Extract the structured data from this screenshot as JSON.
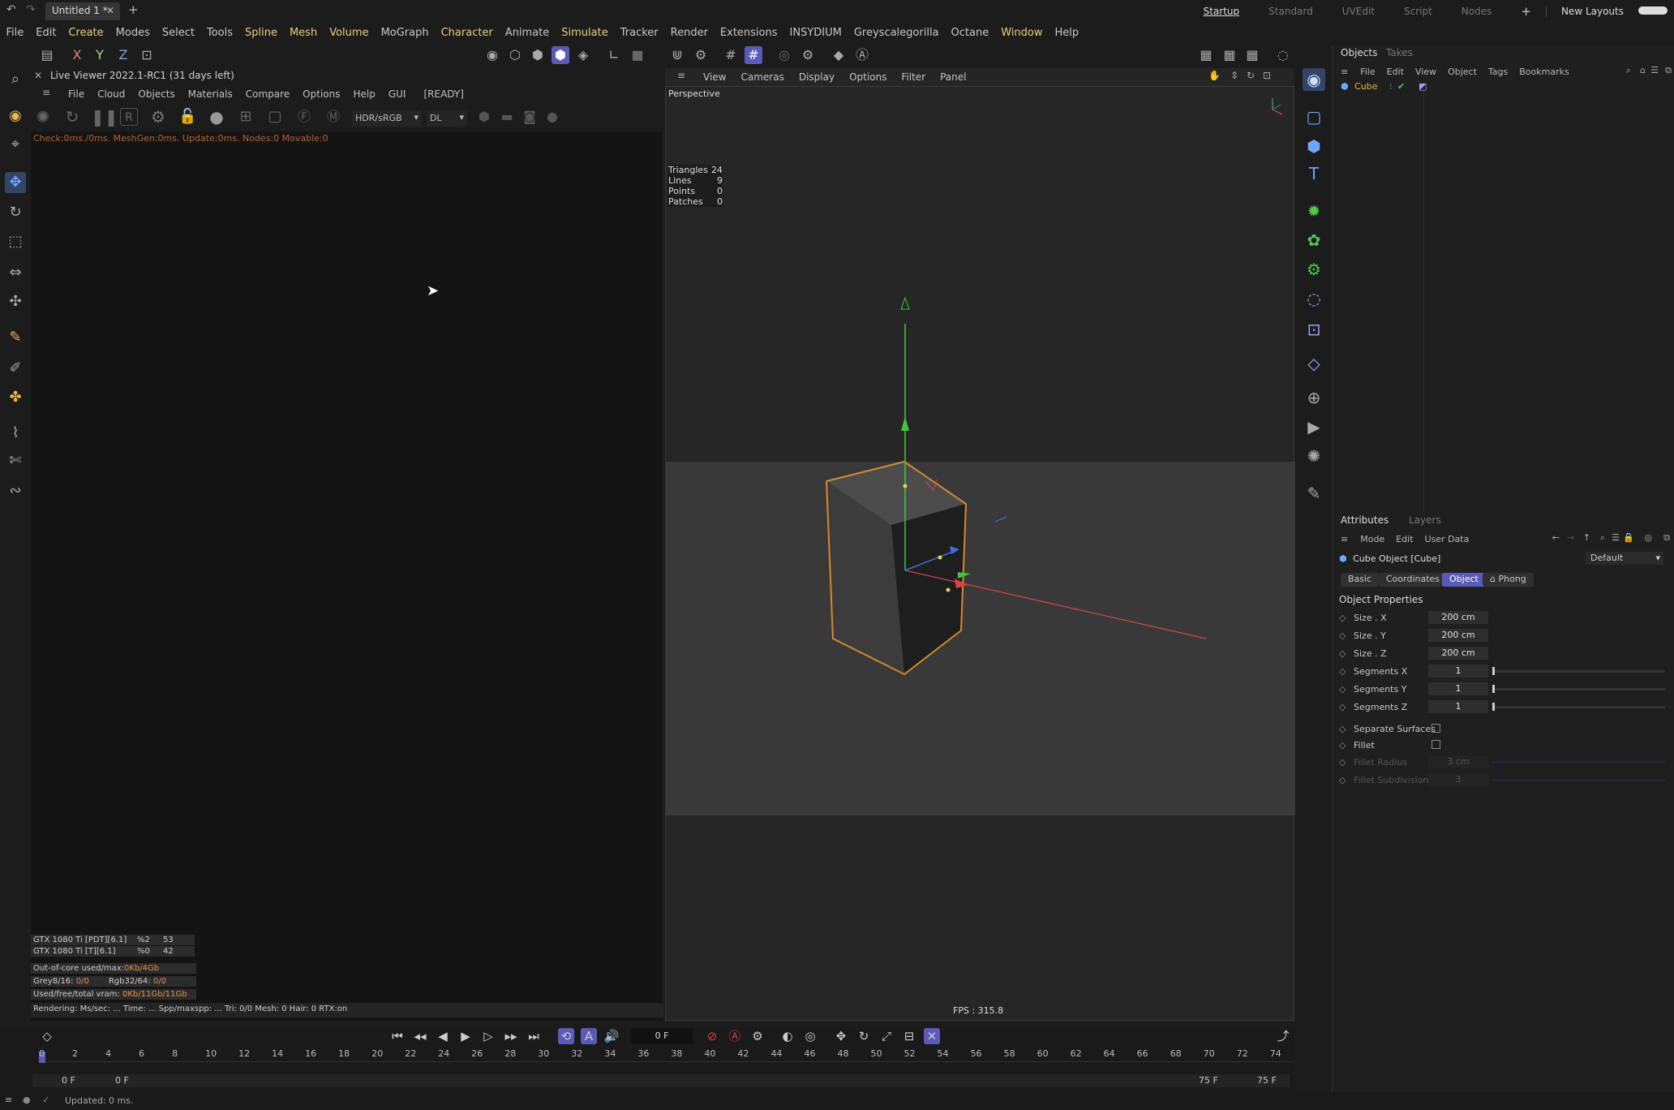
{
  "titlebar": {
    "doc_tab": "Untitled 1 *",
    "close": "✕",
    "new_tab": "+",
    "layouts": [
      "Startup",
      "Standard",
      "UVEdit",
      "Script",
      "Nodes"
    ],
    "active_layout": "Startup",
    "add_layout": "+",
    "new_layouts": "New Layouts"
  },
  "menubar": {
    "items": [
      {
        "label": "File",
        "hl": false
      },
      {
        "label": "Edit",
        "hl": false
      },
      {
        "label": "Create",
        "hl": true
      },
      {
        "label": "Modes",
        "hl": false
      },
      {
        "label": "Select",
        "hl": false
      },
      {
        "label": "Tools",
        "hl": false
      },
      {
        "label": "Spline",
        "hl": true
      },
      {
        "label": "Mesh",
        "hl": true
      },
      {
        "label": "Volume",
        "hl": true
      },
      {
        "label": "MoGraph",
        "hl": false
      },
      {
        "label": "Character",
        "hl": true
      },
      {
        "label": "Animate",
        "hl": false
      },
      {
        "label": "Simulate",
        "hl": true
      },
      {
        "label": "Tracker",
        "hl": false
      },
      {
        "label": "Render",
        "hl": false
      },
      {
        "label": "Extensions",
        "hl": false
      },
      {
        "label": "INSYDIUM",
        "hl": false
      },
      {
        "label": "Greyscalegorilla",
        "hl": false
      },
      {
        "label": "Octane",
        "hl": false
      },
      {
        "label": "Window",
        "hl": true
      },
      {
        "label": "Help",
        "hl": false
      }
    ]
  },
  "toolbar": {
    "axis_x": "X",
    "axis_y": "Y",
    "axis_z": "Z"
  },
  "live_viewer": {
    "title": "Live Viewer 2022.1-RC1 (31 days left)",
    "menu": [
      "File",
      "Cloud",
      "Objects",
      "Materials",
      "Compare",
      "Options",
      "Help",
      "GUI",
      "[READY]"
    ],
    "status_line": "Check:0ms./0ms. MeshGen:0ms. Update:0ms. Nodes:0 Movable:0",
    "color_space": "HDR/sRGB",
    "kernel": "DL",
    "gpu_rows": [
      {
        "name": "GTX 1080 Ti [PDT][6.1]",
        "pct": "%2",
        "temp": "53"
      },
      {
        "name": "GTX 1080 Ti [T][6.1]",
        "pct": "%0",
        "temp": "42"
      }
    ],
    "out_of_core_label": "Out-of-core used/max:",
    "out_of_core_value": "0Kb/4Gb",
    "grey_label": "Grey8/16:",
    "grey_value": "0/0",
    "rgb_label": "Rgb32/64:",
    "rgb_value": "0/0",
    "vram_label": "Used/free/total vram:",
    "vram_value": "0Kb/11Gb/11Gb",
    "render_status": "Rendering:     Ms/sec: ...   Time: ...   Spp/maxspp: ...   Tri: 0/0   Mesh: 0   Hair: 0   RTX:on"
  },
  "viewport": {
    "menu": [
      "View",
      "Cameras",
      "Display",
      "Options",
      "Filter",
      "Panel"
    ],
    "camera": "Perspective",
    "stats": [
      {
        "label": "Triangles",
        "value": "24"
      },
      {
        "label": "Lines",
        "value": "9"
      },
      {
        "label": "Points",
        "value": "0"
      },
      {
        "label": "Patches",
        "value": "0"
      }
    ],
    "fps": "FPS : 315.8"
  },
  "objects_panel": {
    "tabs": [
      "Objects",
      "Takes"
    ],
    "menu": [
      "File",
      "Edit",
      "View",
      "Object",
      "Tags",
      "Bookmarks"
    ],
    "items": [
      {
        "name": "Cube"
      }
    ]
  },
  "attributes_panel": {
    "tabs": [
      "Attributes",
      "Layers"
    ],
    "menu": [
      "Mode",
      "Edit",
      "User Data"
    ],
    "object_title": "Cube Object [Cube]",
    "preset": "Default",
    "subtabs": [
      "Basic",
      "Coordinates",
      "Object",
      "Phong"
    ],
    "active_subtab": "Object",
    "section": "Object Properties",
    "props": [
      {
        "label": "Size . X",
        "value": "200 cm"
      },
      {
        "label": "Size . Y",
        "value": "200 cm"
      },
      {
        "label": "Size . Z",
        "value": "200 cm"
      },
      {
        "label": "Segments X",
        "value": "1"
      },
      {
        "label": "Segments Y",
        "value": "1"
      },
      {
        "label": "Segments Z",
        "value": "1"
      }
    ],
    "checks": [
      {
        "label": "Separate Surfaces",
        "checked": false
      },
      {
        "label": "Fillet",
        "checked": false
      }
    ],
    "disabled_props": [
      {
        "label": "Fillet Radius",
        "value": "3 cm"
      },
      {
        "label": "Fillet Subdivision",
        "value": "3"
      }
    ]
  },
  "timeline": {
    "current_frame": "0 F",
    "ruler_ticks": [
      "0",
      "2",
      "4",
      "6",
      "8",
      "10",
      "12",
      "14",
      "16",
      "18",
      "20",
      "22",
      "24",
      "26",
      "28",
      "30",
      "32",
      "34",
      "36",
      "38",
      "40",
      "42",
      "44",
      "46",
      "48",
      "50",
      "52",
      "54",
      "56",
      "58",
      "60",
      "62",
      "64",
      "66",
      "68",
      "70",
      "72",
      "74"
    ],
    "start": "0 F",
    "start2": "0 F",
    "end": "75 F",
    "end2": "75 F"
  },
  "statusbar": {
    "text": "Updated: 0 ms."
  }
}
